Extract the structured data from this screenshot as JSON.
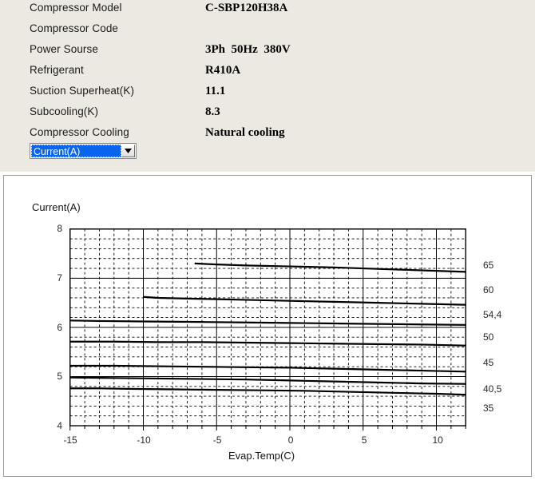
{
  "info": {
    "rows": [
      {
        "label": "Compressor  Model",
        "value": "C-SBP120H38A"
      },
      {
        "label": "Compressor Code",
        "value": ""
      },
      {
        "label": "Power Sourse",
        "value": "3Ph  50Hz  380V"
      },
      {
        "label": "Refrigerant",
        "value": "R410A"
      },
      {
        "label": "Suction Superheat(K)",
        "value": "11.1"
      },
      {
        "label": "Subcooling(K)",
        "value": "8.3"
      },
      {
        "label": "Compressor Cooling",
        "value": "Natural cooling"
      }
    ]
  },
  "combo": {
    "selected": "Current(A)",
    "dropdown_icon": "chevron-down-icon"
  },
  "chart_data": {
    "type": "line",
    "title": "",
    "ylabel": "Current(A)",
    "xlabel": "Evap.Temp(C)",
    "xlim": [
      -15,
      12
    ],
    "ylim": [
      4,
      8
    ],
    "xticks": [
      -15,
      -10,
      -5,
      0,
      5,
      10
    ],
    "yticks": [
      4,
      5,
      6,
      7,
      8
    ],
    "grid": true,
    "grid_minor_x_step": 1,
    "grid_minor_y_step": 0.2,
    "legend": "right-axis-labels",
    "series_label_title": "Cond.Temp(C)",
    "series": [
      {
        "name": "65",
        "x": [
          -6.5,
          -5.0,
          -3.0,
          0.0,
          3.0,
          6.0,
          9.0,
          12.0
        ],
        "values": [
          7.3,
          7.28,
          7.26,
          7.24,
          7.22,
          7.19,
          7.16,
          7.13
        ]
      },
      {
        "name": "60",
        "x": [
          -10.0,
          -9.0,
          -6.0,
          -3.0,
          0.0,
          3.0,
          6.0,
          9.0,
          12.0
        ],
        "values": [
          6.62,
          6.6,
          6.58,
          6.56,
          6.54,
          6.52,
          6.5,
          6.48,
          6.46
        ]
      },
      {
        "name": "54,4",
        "x": [
          -15.0,
          -13.0,
          -10.0,
          -6.0,
          -3.0,
          0.0,
          3.0,
          6.0,
          9.0,
          12.0
        ],
        "values": [
          6.14,
          6.13,
          6.12,
          6.11,
          6.1,
          6.09,
          6.08,
          6.07,
          6.06,
          6.05
        ]
      },
      {
        "name": "50",
        "x": [
          -15.0,
          -12.0,
          -9.0,
          -6.0,
          -3.0,
          0.0,
          3.0,
          6.0,
          9.0,
          12.0
        ],
        "values": [
          5.71,
          5.71,
          5.7,
          5.7,
          5.69,
          5.68,
          5.67,
          5.66,
          5.65,
          5.63
        ]
      },
      {
        "name": "45",
        "x": [
          -15.0,
          -12.0,
          -9.0,
          -6.0,
          -3.0,
          0.0,
          3.0,
          6.0,
          9.0,
          12.0
        ],
        "values": [
          5.22,
          5.22,
          5.21,
          5.2,
          5.19,
          5.18,
          5.16,
          5.14,
          5.12,
          5.1
        ]
      },
      {
        "name": "40,5",
        "x": [
          -15.0,
          -12.0,
          -9.0,
          -6.0,
          -3.0,
          0.0,
          3.0,
          6.0,
          9.0,
          12.0
        ],
        "values": [
          4.98,
          4.97,
          4.96,
          4.95,
          4.94,
          4.92,
          4.9,
          4.88,
          4.86,
          4.85
        ]
      },
      {
        "name": "35",
        "x": [
          -15.0,
          -13.0,
          -11.0,
          -8.0,
          -5.0,
          -2.0,
          1.0,
          4.0,
          7.0,
          10.0,
          12.0
        ],
        "values": [
          4.76,
          4.76,
          4.75,
          4.74,
          4.73,
          4.72,
          4.71,
          4.69,
          4.67,
          4.65,
          4.63
        ]
      }
    ],
    "right_labels": [
      {
        "text": "65",
        "y": 7.25
      },
      {
        "text": "60",
        "y": 6.75
      },
      {
        "text": "54,4",
        "y": 6.25
      },
      {
        "text": "50",
        "y": 5.8
      },
      {
        "text": "45",
        "y": 5.28
      },
      {
        "text": "40,5",
        "y": 4.75
      },
      {
        "text": "35",
        "y": 4.35
      }
    ]
  }
}
